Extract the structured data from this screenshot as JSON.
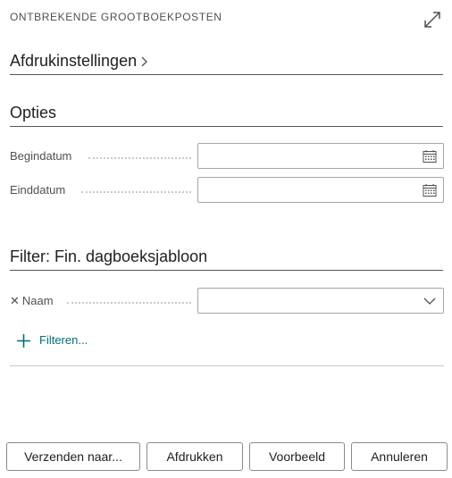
{
  "dialog": {
    "title": "ONTBREKENDE GROOTBOEKPOSTEN"
  },
  "sections": {
    "print_settings": "Afdrukinstellingen",
    "options": "Opties",
    "filter": "Filter: Fin. dagboeksjabloon"
  },
  "options": {
    "start_date": {
      "label": "Begindatum",
      "value": ""
    },
    "end_date": {
      "label": "Einddatum",
      "value": ""
    }
  },
  "filter": {
    "name": {
      "label": "Naam",
      "value": ""
    },
    "add_filter_label": "Filteren..."
  },
  "buttons": {
    "send_to": "Verzenden naar...",
    "print": "Afdrukken",
    "preview": "Voorbeeld",
    "cancel": "Annuleren"
  },
  "icons": {
    "expand": "expand-icon",
    "chevron": "chevron-right-icon",
    "calendar": "calendar-icon",
    "dropdown": "chevron-down-icon",
    "remove": "close-icon",
    "add": "plus-icon"
  },
  "colors": {
    "accent": "#00707a",
    "border": "#a6a6a6",
    "text": "#212121"
  }
}
